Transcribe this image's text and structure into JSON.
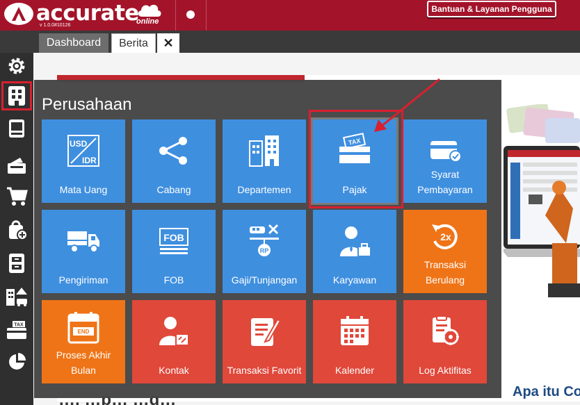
{
  "app": {
    "brand": "accurate",
    "brand_sub": "online",
    "version": "v 1.0.0#10126",
    "help_button": "Bantuan & Layanan Pengguna"
  },
  "tabs": [
    {
      "label": "Dashboard",
      "active": false
    },
    {
      "label": "Berita",
      "active": true
    },
    {
      "label": "✕",
      "role": "close"
    }
  ],
  "sidebar": {
    "items": [
      {
        "icon": "gear-icon"
      },
      {
        "icon": "company-icon",
        "active": true
      },
      {
        "icon": "ledger-icon"
      },
      {
        "icon": "wallet-icon"
      },
      {
        "icon": "cart-icon"
      },
      {
        "icon": "bag-add-icon"
      },
      {
        "icon": "cabinet-icon"
      },
      {
        "icon": "buildings-icon"
      },
      {
        "icon": "tax-icon"
      },
      {
        "icon": "pie-chart-icon"
      }
    ]
  },
  "menu": {
    "title": "Perusahaan",
    "tiles": [
      {
        "label": "Mata Uang",
        "icon": "currency-icon",
        "color": "#3f8fdf"
      },
      {
        "label": "Cabang",
        "icon": "branch-icon",
        "color": "#3f8fdf"
      },
      {
        "label": "Departemen",
        "icon": "department-icon",
        "color": "#3f8fdf"
      },
      {
        "label": "Pajak",
        "icon": "tax-icon",
        "color": "#3f8fdf",
        "highlighted": true
      },
      {
        "label": "Syarat Pembayaran",
        "icon": "payment-terms-icon",
        "color": "#3f8fdf"
      },
      {
        "label": "Pengiriman",
        "icon": "truck-icon",
        "color": "#3f8fdf"
      },
      {
        "label": "FOB",
        "icon": "fob-icon",
        "color": "#3f8fdf"
      },
      {
        "label": "Gaji/Tunjangan",
        "icon": "salary-icon",
        "color": "#3f8fdf"
      },
      {
        "label": "Karyawan",
        "icon": "employee-icon",
        "color": "#3f8fdf"
      },
      {
        "label": "Transaksi Berulang",
        "icon": "recurring-icon",
        "color": "#ef7417"
      },
      {
        "label": "Proses Akhir Bulan",
        "icon": "month-end-icon",
        "color": "#ef7417"
      },
      {
        "label": "Kontak",
        "icon": "contact-icon",
        "color": "#e0483a"
      },
      {
        "label": "Transaksi Favorit",
        "icon": "favorite-transaction-icon",
        "color": "#e0483a"
      },
      {
        "label": "Kalender",
        "icon": "calendar-icon",
        "color": "#e0483a"
      },
      {
        "label": "Log Aktifitas",
        "icon": "activity-log-icon",
        "color": "#e0483a"
      }
    ],
    "tile_icon_text": {
      "currency_top": "USD",
      "currency_bottom": "IDR",
      "tax": "TAX",
      "fob": "FOB",
      "salary": "RP",
      "recurring": "2x",
      "month_end": "END"
    }
  },
  "background": {
    "headline": "…, …p… …g…",
    "side_heading": "Apa itu Co"
  },
  "colors": {
    "brand": "#a3142a",
    "tile_blue": "#3f8fdf",
    "tile_orange": "#ef7417",
    "tile_red": "#e0483a",
    "highlight": "#d9202f"
  }
}
